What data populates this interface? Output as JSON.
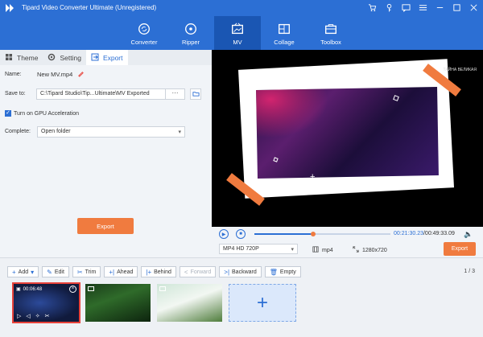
{
  "app": {
    "title": "Tipard Video Converter Ultimate (Unregistered)"
  },
  "window_icons": [
    "cart-icon",
    "key-icon",
    "chat-icon",
    "menu-icon",
    "minimize-icon",
    "maximize-icon",
    "close-icon"
  ],
  "nav": [
    {
      "label": "Converter",
      "icon": "converter-icon",
      "active": false
    },
    {
      "label": "Ripper",
      "icon": "ripper-icon",
      "active": false
    },
    {
      "label": "MV",
      "icon": "mv-icon",
      "active": true
    },
    {
      "label": "Collage",
      "icon": "collage-icon",
      "active": false
    },
    {
      "label": "Toolbox",
      "icon": "toolbox-icon",
      "active": false
    }
  ],
  "tabs": [
    {
      "label": "Theme",
      "active": false
    },
    {
      "label": "Setting",
      "active": false
    },
    {
      "label": "Export",
      "active": true
    }
  ],
  "export": {
    "name_label": "Name:",
    "name_value": "New MV.mp4",
    "save_label": "Save to:",
    "save_path": "C:\\Tipard Studio\\Tip...Ultimate\\MV Exported",
    "save_browse": "···",
    "gpu_label": "Turn on GPU Acceleration",
    "gpu_checked": true,
    "complete_label": "Complete:",
    "complete_value": "Open folder",
    "button": "Export"
  },
  "preview": {
    "watermark": "ТАЙНА ВЕЛИКАЯ",
    "accent_color": "#f07b3f"
  },
  "player": {
    "current_time": "00:21:30.23",
    "total_time": "/00:49:33.09",
    "progress": 0.43,
    "format": "MP4 HD 720P",
    "container": "mp4",
    "resolution": "1280x720",
    "export_button": "Export"
  },
  "toolbar": {
    "add": "Add",
    "edit": "Edit",
    "trim": "Trim",
    "ahead": "Ahead",
    "behind": "Behind",
    "forward": "Forward",
    "backward": "Backward",
    "empty": "Empty",
    "page": "1 / 3"
  },
  "clips": [
    {
      "time": "00:06:48",
      "selected": true
    }
  ],
  "colors": {
    "brand": "#2c6fd4",
    "accent": "#f07b3f"
  }
}
